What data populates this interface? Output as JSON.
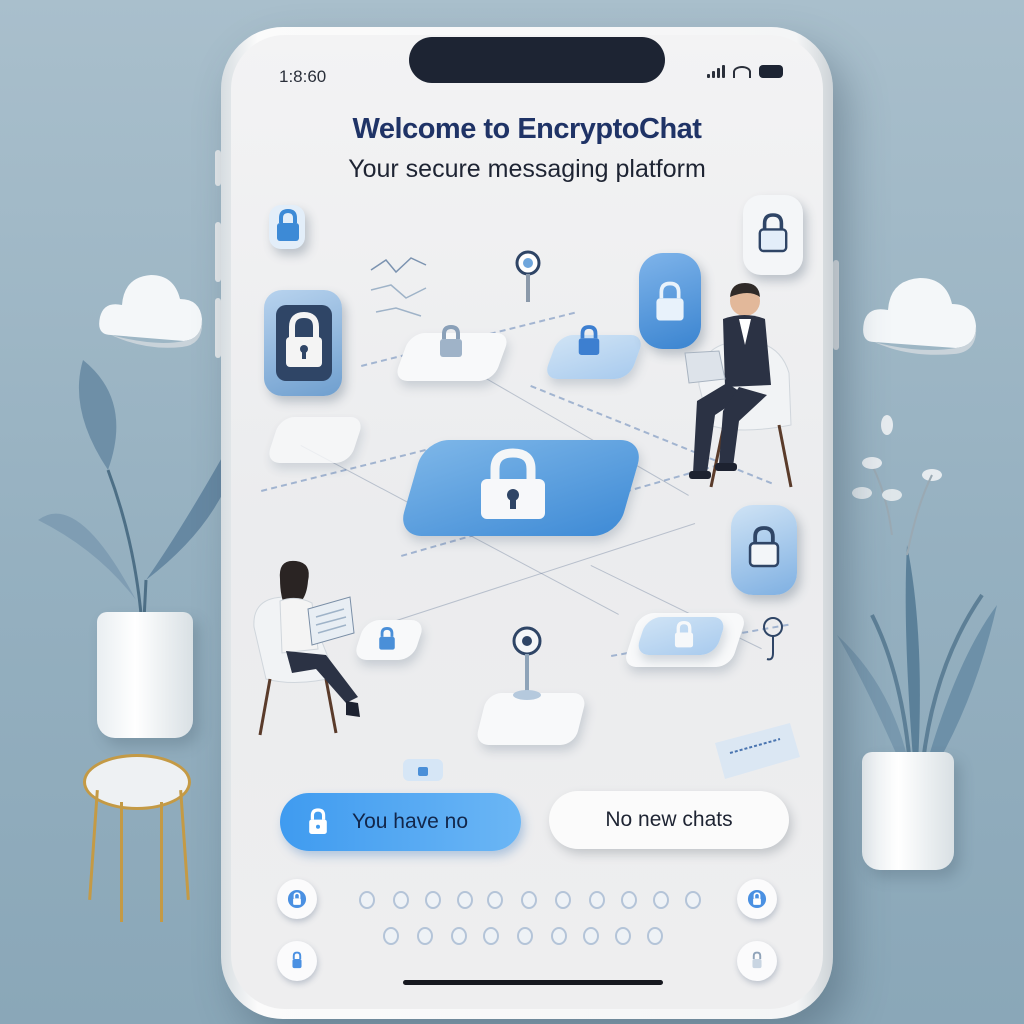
{
  "status_bar": {
    "time": "1:8:60"
  },
  "header": {
    "title": "Welcome to EncryptoChat",
    "subtitle": "Your secure messaging platform"
  },
  "actions": {
    "primary_label": "You have no",
    "secondary_label": "No new chats"
  },
  "colors": {
    "accent": "#4aa3f2",
    "title": "#1f3366",
    "background": "#9db5c4",
    "screen": "#efeff0"
  },
  "icons": {
    "primary_button": "lock-icon",
    "bottom_nav": [
      "lock-icon",
      "lock-icon",
      "lock-icon",
      "lock-icon"
    ]
  }
}
